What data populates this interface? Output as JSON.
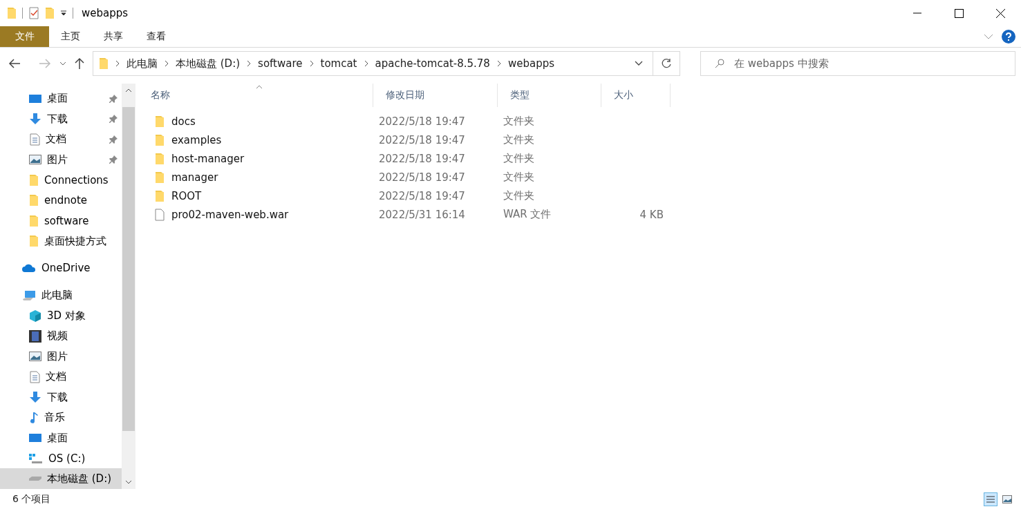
{
  "window": {
    "title": "webapps"
  },
  "ribbon_tabs": [
    {
      "label": "文件",
      "kind": "file"
    },
    {
      "label": "主页",
      "kind": "tab"
    },
    {
      "label": "共享",
      "kind": "tab"
    },
    {
      "label": "查看",
      "kind": "tab"
    }
  ],
  "breadcrumb": [
    "此电脑",
    "本地磁盘 (D:)",
    "software",
    "tomcat",
    "apache-tomcat-8.5.78",
    "webapps"
  ],
  "search": {
    "placeholder": "在 webapps 中搜索"
  },
  "sidebar": {
    "items": [
      {
        "label": "桌面",
        "kind": "desktop",
        "pinned": true,
        "selected": false
      },
      {
        "label": "下载",
        "kind": "download",
        "pinned": true,
        "selected": false
      },
      {
        "label": "文档",
        "kind": "document",
        "pinned": true,
        "selected": false
      },
      {
        "label": "图片",
        "kind": "picture",
        "pinned": true,
        "selected": false
      },
      {
        "label": "Connections",
        "kind": "folder",
        "pinned": false,
        "selected": false
      },
      {
        "label": "endnote",
        "kind": "folder",
        "pinned": false,
        "selected": false
      },
      {
        "label": "software",
        "kind": "folder",
        "pinned": false,
        "selected": false
      },
      {
        "label": "桌面快捷方式",
        "kind": "folder",
        "pinned": false,
        "selected": false
      },
      {
        "label": "OneDrive",
        "kind": "cloud",
        "pinned": false,
        "selected": false,
        "top": true
      },
      {
        "label": "此电脑",
        "kind": "pc",
        "pinned": false,
        "selected": false,
        "top": true,
        "children": [
          {
            "label": "3D 对象",
            "kind": "cube",
            "pinned": false,
            "selected": false
          },
          {
            "label": "视频",
            "kind": "video",
            "pinned": false,
            "selected": false
          },
          {
            "label": "图片",
            "kind": "picture",
            "pinned": false,
            "selected": false
          },
          {
            "label": "文档",
            "kind": "document",
            "pinned": false,
            "selected": false
          },
          {
            "label": "下载",
            "kind": "download",
            "pinned": false,
            "selected": false
          },
          {
            "label": "音乐",
            "kind": "music",
            "pinned": false,
            "selected": false
          },
          {
            "label": "桌面",
            "kind": "desktop",
            "pinned": false,
            "selected": false
          },
          {
            "label": "OS (C:)",
            "kind": "osdrive",
            "pinned": false,
            "selected": false
          },
          {
            "label": "本地磁盘 (D:)",
            "kind": "drive",
            "pinned": false,
            "selected": true
          }
        ]
      }
    ]
  },
  "table": {
    "columns": [
      {
        "label": "名称",
        "sorted": true
      },
      {
        "label": "修改日期",
        "sorted": false
      },
      {
        "label": "类型",
        "sorted": false
      },
      {
        "label": "大小",
        "sorted": false
      }
    ],
    "rows": [
      {
        "kind": "folder",
        "name": "docs",
        "date": "2022/5/18 19:47",
        "type": "文件夹"
      },
      {
        "kind": "folder",
        "name": "examples",
        "date": "2022/5/18 19:47",
        "type": "文件夹"
      },
      {
        "kind": "folder",
        "name": "host-manager",
        "date": "2022/5/18 19:47",
        "type": "文件夹"
      },
      {
        "kind": "folder",
        "name": "manager",
        "date": "2022/5/18 19:47",
        "type": "文件夹"
      },
      {
        "kind": "folder",
        "name": "ROOT",
        "date": "2022/5/18 19:47",
        "type": "文件夹"
      },
      {
        "kind": "file",
        "name": "pro02-maven-web.war",
        "date": "2022/5/31 16:14",
        "type": "WAR 文件",
        "size": "4 KB"
      }
    ]
  },
  "status_bar": {
    "count": "6 个项目",
    "view_buttons": [
      {
        "kind": "details",
        "selected": true
      },
      {
        "kind": "icons",
        "selected": false
      }
    ]
  }
}
